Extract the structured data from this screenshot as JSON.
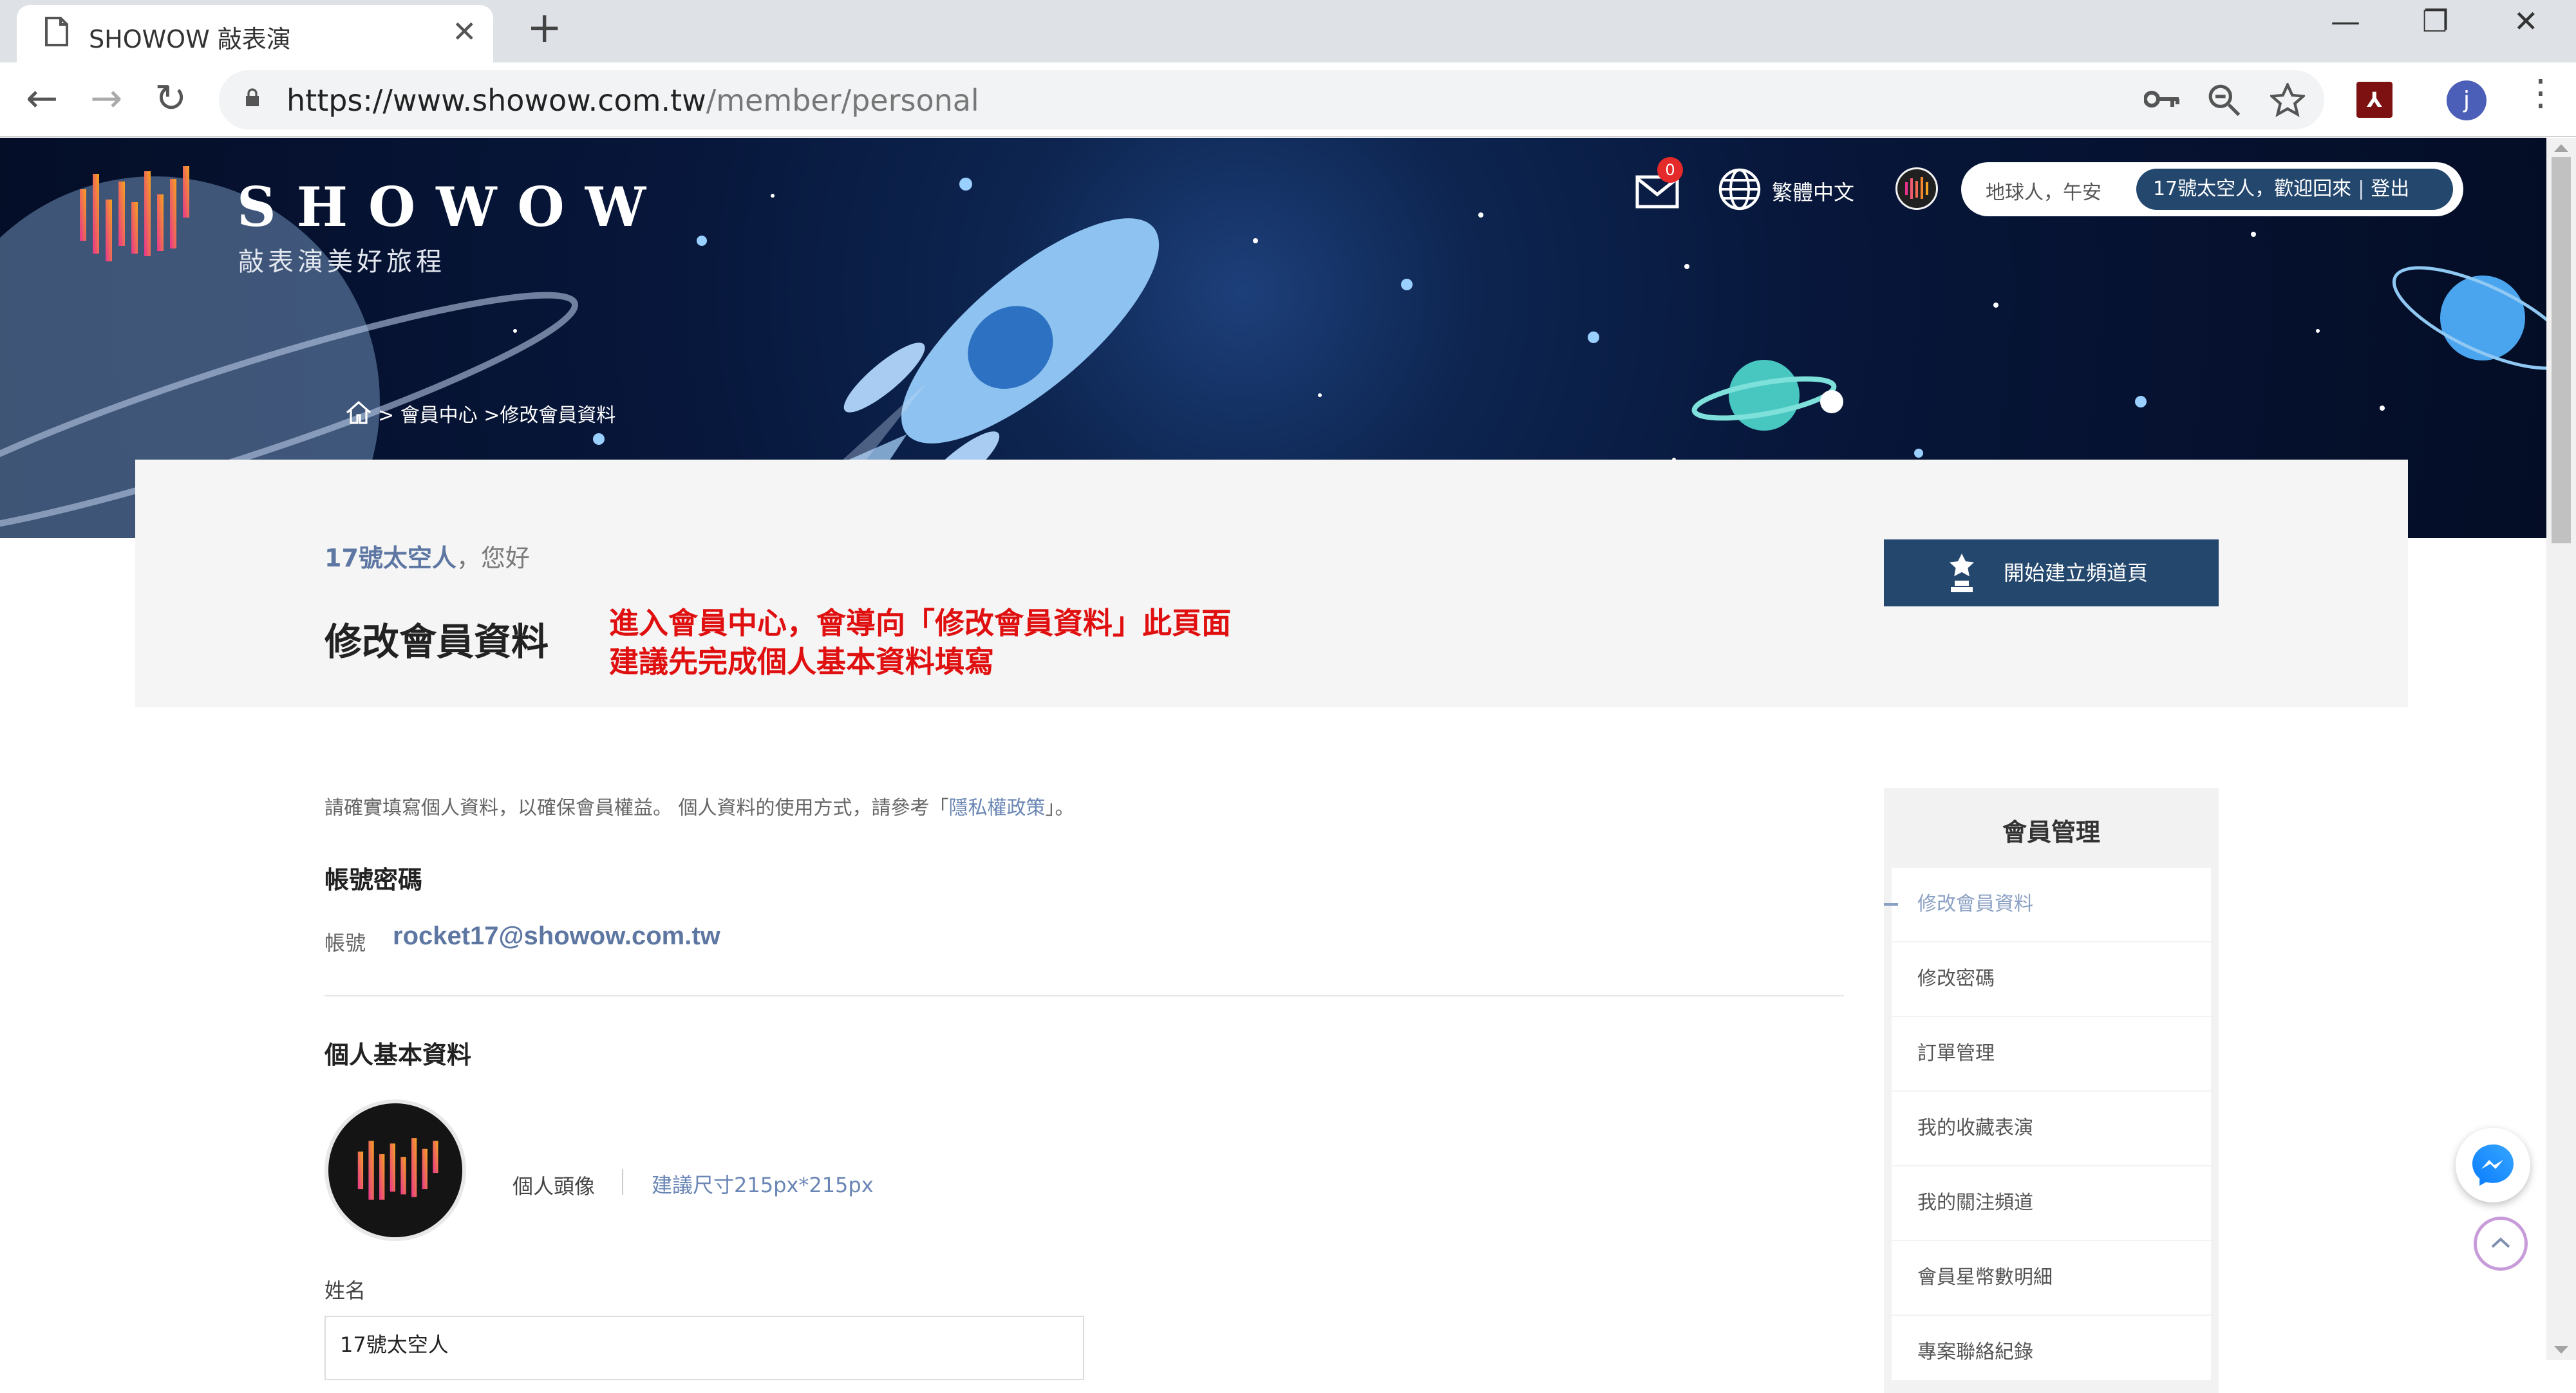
{
  "browser": {
    "tab_title": "SHOWOW 敲表演",
    "url_host": "https://www.showow.com.tw",
    "url_path": "/member/personal"
  },
  "header": {
    "brand": "SHOWOW",
    "slogan": "敲表演美好旅程",
    "mail_count": "0",
    "language": "繁體中文",
    "greeting": "地球人，午安",
    "user_name": "17號太空人",
    "welcome": "，歡迎回來",
    "logout": "登出",
    "breadcrumb": {
      "sep1": ">",
      "member_center": "會員中心",
      "sep2": ">",
      "current": "修改會員資料"
    }
  },
  "main": {
    "hello_name": "17號太空人",
    "hello_suffix": "，您好",
    "page_title": "修改會員資料",
    "note_line1": "進入會員中心，會導向「修改會員資料」此頁面",
    "note_line2": "建議先完成個人基本資料填寫",
    "channel_button": "開始建立頻道頁",
    "intro_prefix": "請確實填寫個人資料，以確保會員權益。 個人資料的使用方式，請參考「",
    "intro_link": "隱私權政策",
    "intro_suffix": "」。",
    "account_section": "帳號密碼",
    "account_label": "帳號",
    "account_value": "rocket17@showow.com.tw",
    "personal_section": "個人基本資料",
    "avatar_label": "個人頭像",
    "avatar_hint": "建議尺寸215px*215px",
    "name_label": "姓名",
    "name_value": "17號太空人"
  },
  "sidebar": {
    "title": "會員管理",
    "items": [
      {
        "label": "修改會員資料"
      },
      {
        "label": "修改密碼"
      },
      {
        "label": "訂單管理"
      },
      {
        "label": "我的收藏表演"
      },
      {
        "label": "我的關注頻道"
      },
      {
        "label": "會員星幣數明細"
      },
      {
        "label": "專案聯絡紀錄"
      }
    ]
  },
  "colors": {
    "primary_navy": "#24476e",
    "note_red": "#e01010",
    "link_blue": "#6a86b4",
    "hero_bg": "#07163a"
  }
}
